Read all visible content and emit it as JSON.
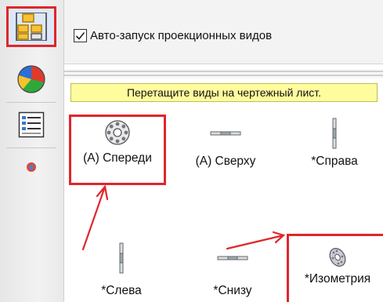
{
  "options": {
    "auto_start_checked": true,
    "auto_start_label": "Авто-запуск проекционных видов"
  },
  "hint": {
    "text": "Перетащите виды на чертежный лист."
  },
  "tabs": [
    {
      "name": "view-palette-icon",
      "selected": true
    },
    {
      "name": "appearance-icon",
      "selected": false
    },
    {
      "name": "property-list-icon",
      "selected": false
    },
    {
      "name": "custom-properties-icon",
      "selected": false
    }
  ],
  "views": {
    "front": "(A) Спереди",
    "top": "(A) Сверху",
    "right": "*Справа",
    "left": "*Слева",
    "bottom": "*Снизу",
    "iso": "*Изометрия"
  },
  "colors": {
    "highlight": "#e0262b",
    "hint_bg": "#fffc9e"
  }
}
